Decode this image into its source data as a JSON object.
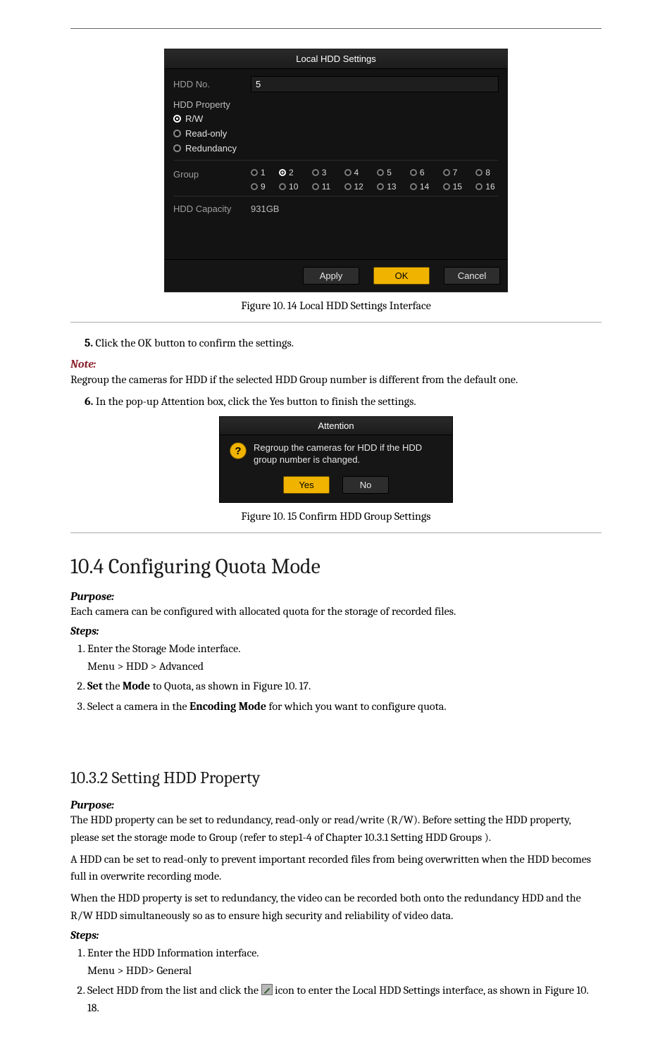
{
  "fig14": {
    "dialog_title": "Local HDD Settings",
    "hdd_no_label": "HDD No.",
    "hdd_no_value": "5",
    "property_section": "HDD Property",
    "prop_rw": "R/W",
    "prop_ro": "Read-only",
    "prop_red": "Redundancy",
    "group_label": "Group",
    "groups": [
      "1",
      "2",
      "3",
      "4",
      "5",
      "6",
      "7",
      "8",
      "9",
      "10",
      "11",
      "12",
      "13",
      "14",
      "15",
      "16"
    ],
    "group_selected_index": 1,
    "capacity_label": "HDD Capacity",
    "capacity_value": "931GB",
    "btn_apply": "Apply",
    "btn_ok": "OK",
    "btn_cancel": "Cancel",
    "caption": "Figure 10. 14 Local HDD Settings Interface"
  },
  "step5": "Click the OK button to confirm the settings.",
  "note_label": "Note:",
  "note_body": "Regroup the cameras for HDD if the selected HDD Group number is different from the default one.",
  "step6": "In the pop-up Attention box, click the Yes button to finish the settings.",
  "fig15": {
    "title": "Attention",
    "msg": "Regroup the cameras for HDD if the HDD group number is changed.",
    "yes": "Yes",
    "no": "No",
    "caption": "Figure 10. 15 Confirm HDD Group Settings"
  },
  "sec104": {
    "heading": "10.4 Configuring Quota Mode",
    "purpose_lbl": "Purpose:",
    "purpose_txt": "Each camera can be configured with allocated quota for the storage of recorded files.",
    "steps_lbl": "Steps:",
    "s1a": "Enter the Storage Mode interface.",
    "s1b": "Menu > HDD > Advanced",
    "s2": "Set the Mode to Quota, as shown in Figure 10. 17.",
    "s3_pre": "Select a camera in the ",
    "s3_bold": "Encoding Mode",
    "s3_post": " for which you want to configure quota."
  },
  "sec1032": {
    "heading": "10.3.2 Setting HDD Property",
    "purpose_lbl": "Purpose:",
    "purpose_txt": "The HDD property can be set to redundancy, read-only or read/write (R/W). Before setting the HDD property, please set the storage mode to Group (refer to step1-4 of Chapter 10.3.1 Setting HDD Groups ).",
    "p2": "A HDD can be set to read-only to prevent important recorded files from being overwritten when the HDD becomes full in overwrite recording mode.",
    "p3": "When the HDD property is set to redundancy, the video can be recorded both onto the redundancy HDD and the R/W HDD simultaneously so as to ensure high security and reliability of video data.",
    "steps_lbl": "Steps:",
    "s1a": "Enter the HDD Information interface.",
    "s1b": "Menu > HDD> General",
    "s2_pre": "Select HDD from the list and click the ",
    "s2_post": " icon to enter the Local HDD Settings interface, as shown in Figure 10. 18."
  }
}
